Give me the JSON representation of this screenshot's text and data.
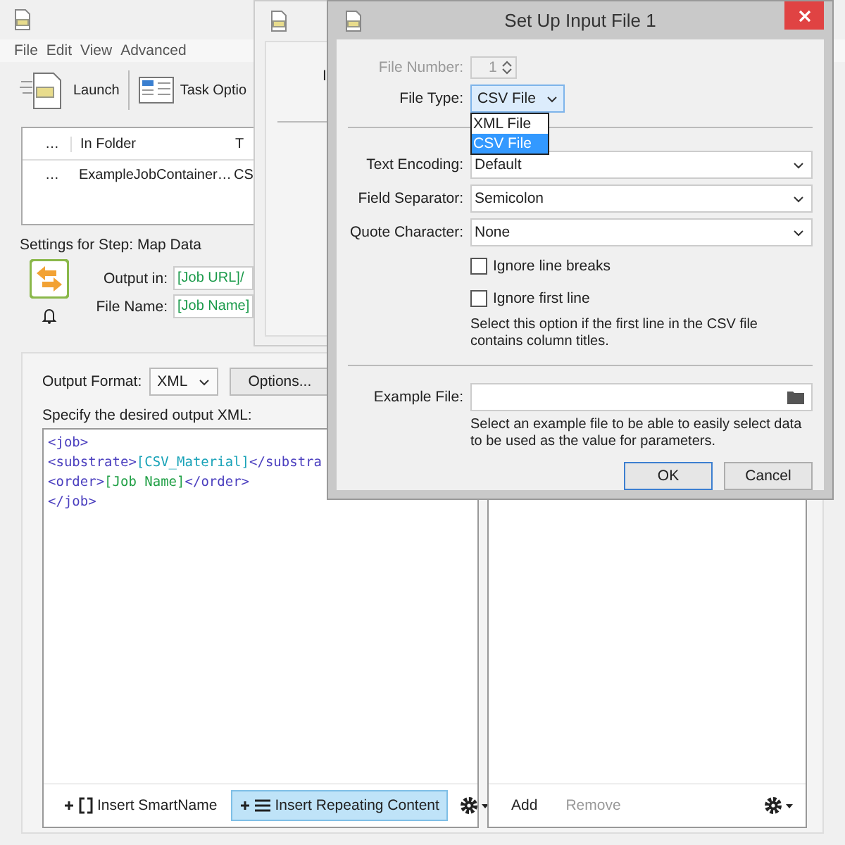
{
  "main_window": {
    "menu": [
      "File",
      "Edit",
      "View",
      "Advanced"
    ],
    "toolbar": [
      {
        "label": "Launch",
        "kind": "launch"
      },
      {
        "label": "Task Optio",
        "kind": "options"
      }
    ],
    "table": {
      "columns": [
        "…",
        "In Folder",
        "T"
      ],
      "rows": [
        [
          "…",
          "ExampleJobContainer…",
          "CS"
        ]
      ]
    },
    "step_title": "Settings for Step: Map Data",
    "output_in": {
      "label": "Output in:",
      "value": "[Job URL]/"
    },
    "file_name": {
      "label": "File Name:",
      "value": "[Job Name]"
    },
    "output_format": {
      "label": "Output Format:",
      "value": "XML"
    },
    "options_button": "Options...",
    "xml_label": "Specify the desired output XML:",
    "xml_lines": [
      [
        {
          "kind": "tag",
          "text": "<job>"
        }
      ],
      [
        {
          "kind": "tag",
          "text": "<substrate>"
        },
        {
          "kind": "csv",
          "text": "[CSV_Material]"
        },
        {
          "kind": "tag",
          "text": "</substra"
        }
      ],
      [
        {
          "kind": "tag",
          "text": "<order>"
        },
        {
          "kind": "job",
          "text": "[Job Name]"
        },
        {
          "kind": "tag",
          "text": "</order>"
        }
      ],
      [
        {
          "kind": "tag",
          "text": "</job>"
        }
      ]
    ],
    "editor_buttons": [
      {
        "label": "Insert SmartName",
        "kind": "smartname",
        "selected": false
      },
      {
        "label": "Insert Repeating Content",
        "kind": "repeat",
        "selected": true
      }
    ],
    "list_buttons": [
      {
        "label": "Add",
        "disabled": false
      },
      {
        "label": "Remove",
        "disabled": true
      }
    ]
  },
  "back_window": {
    "text": "I"
  },
  "dialog": {
    "title": "Set Up Input File 1",
    "file_number": {
      "label": "File Number:",
      "value": "1",
      "disabled": true
    },
    "file_type": {
      "label": "File Type:",
      "value": "CSV File",
      "expanded": true,
      "options": [
        {
          "label": "XML File",
          "selected": false
        },
        {
          "label": "CSV File",
          "selected": true
        }
      ]
    },
    "selects": [
      {
        "label": "Text Encoding:",
        "value": "Default"
      },
      {
        "label": "Field Separator:",
        "value": "Semicolon"
      },
      {
        "label": "Quote Character:",
        "value": "None"
      }
    ],
    "checkboxes": [
      {
        "label": "Ignore line breaks",
        "checked": false
      },
      {
        "label": "Ignore first line",
        "checked": false
      }
    ],
    "first_line_help": "Select this option if the first line in the CSV file contains column titles.",
    "example_file": {
      "label": "Example File:"
    },
    "example_help": "Select an example file to be able to easily select data to be used as the value for parameters.",
    "buttons": [
      {
        "label": "OK",
        "default": true
      },
      {
        "label": "Cancel",
        "default": false
      }
    ]
  }
}
